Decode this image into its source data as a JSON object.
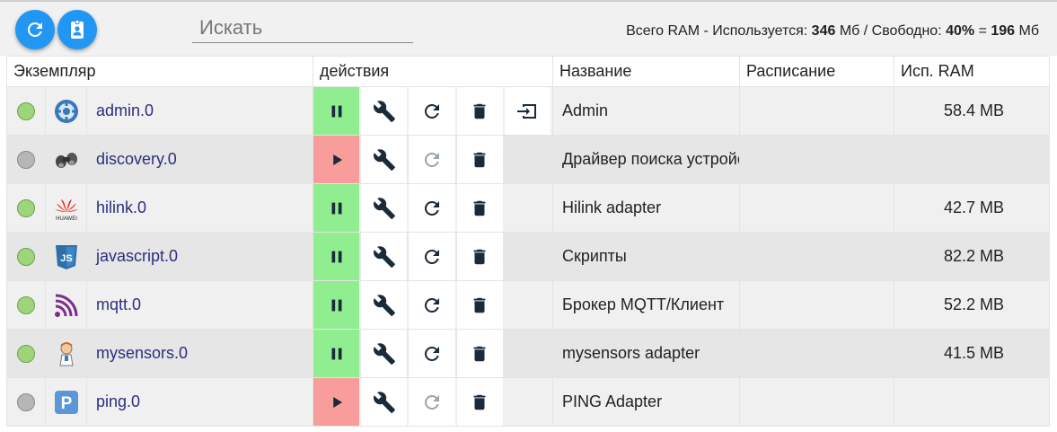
{
  "toolbar": {
    "refresh_icon": "refresh-icon",
    "logs_icon": "contact-badge-icon",
    "search_placeholder": "Искать",
    "ram": {
      "prefix": "Всего RAM - Используется: ",
      "used": "346",
      "used_unit": " Мб / Свободно: ",
      "free_pct": "40%",
      "eq": " = ",
      "free": "196",
      "free_unit": " Мб"
    }
  },
  "table": {
    "headers": {
      "instance": "Экземпляр",
      "actions": "действия",
      "title": "Название",
      "schedule": "Расписание",
      "ram": "Исп. RAM"
    },
    "rows": [
      {
        "instance": "admin.0",
        "title": "Admin",
        "ram": "58.4 MB",
        "running": true,
        "icon": "gear-icon"
      },
      {
        "instance": "discovery.0",
        "title": "Драйвер поиска устройств",
        "ram": "",
        "running": false,
        "icon": "binoculars-icon"
      },
      {
        "instance": "hilink.0",
        "title": "Hilink adapter",
        "ram": "42.7 MB",
        "running": true,
        "icon": "huawei-logo-icon",
        "icon_text": "HUAWEI"
      },
      {
        "instance": "javascript.0",
        "title": "Скрипты",
        "ram": "82.2 MB",
        "running": true,
        "icon": "js-shield-icon",
        "icon_text": "JS"
      },
      {
        "instance": "mqtt.0",
        "title": "Брокер MQTT/Клиент",
        "ram": "52.2 MB",
        "running": true,
        "icon": "mqtt-signal-icon"
      },
      {
        "instance": "mysensors.0",
        "title": "mysensors adapter",
        "ram": "41.5 MB",
        "running": true,
        "icon": "scientist-icon"
      },
      {
        "instance": "ping.0",
        "title": "PING Adapter",
        "ram": "",
        "running": false,
        "icon": "parking-p-icon",
        "icon_text": "P"
      }
    ]
  },
  "colors": {
    "accent": "#2196f3",
    "running": "#90ee90",
    "stopped": "#f89c9c",
    "instance_text": "#2c2e7c",
    "led_on": "#9ed57a",
    "led_off": "#b6b6b6"
  }
}
